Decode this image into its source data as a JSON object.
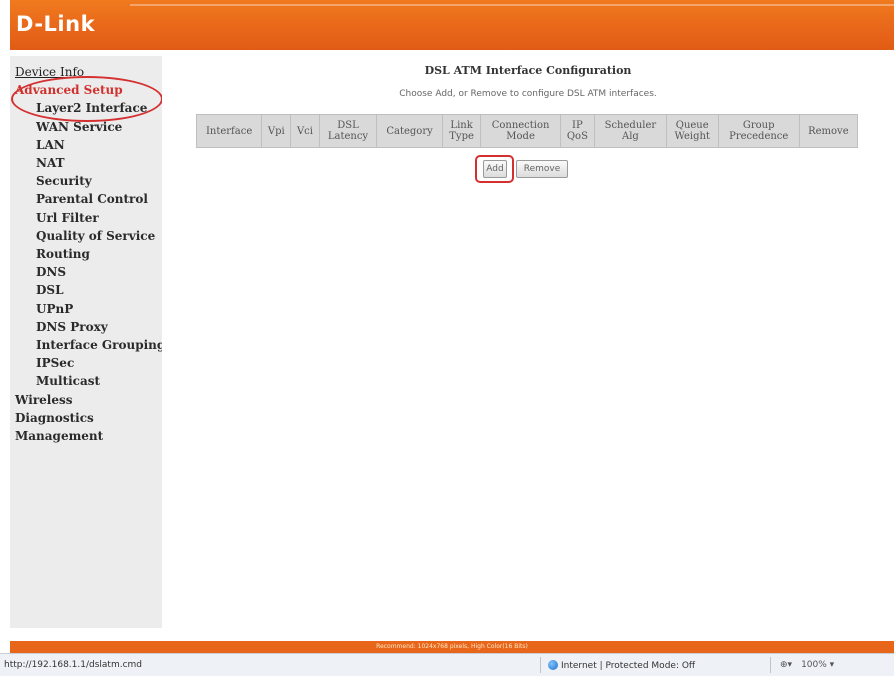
{
  "header": {
    "logo_text": "D-Link"
  },
  "sidebar": {
    "items": [
      {
        "label": "Device Info",
        "level": "top"
      },
      {
        "label": "Advanced Setup",
        "level": "top"
      },
      {
        "label": "Layer2 Interface",
        "level": "sub"
      },
      {
        "label": "WAN Service",
        "level": "sub"
      },
      {
        "label": "LAN",
        "level": "sub"
      },
      {
        "label": "NAT",
        "level": "sub"
      },
      {
        "label": "Security",
        "level": "sub"
      },
      {
        "label": "Parental Control",
        "level": "sub"
      },
      {
        "label": "Url Filter",
        "level": "sub"
      },
      {
        "label": "Quality of Service",
        "level": "sub"
      },
      {
        "label": "Routing",
        "level": "sub"
      },
      {
        "label": "DNS",
        "level": "sub"
      },
      {
        "label": "DSL",
        "level": "sub"
      },
      {
        "label": "UPnP",
        "level": "sub"
      },
      {
        "label": "DNS Proxy",
        "level": "sub"
      },
      {
        "label": "Interface Grouping",
        "level": "sub"
      },
      {
        "label": "IPSec",
        "level": "sub"
      },
      {
        "label": "Multicast",
        "level": "sub"
      },
      {
        "label": "Wireless",
        "level": "top"
      },
      {
        "label": "Diagnostics",
        "level": "top"
      },
      {
        "label": "Management",
        "level": "top"
      }
    ]
  },
  "main": {
    "title": "DSL ATM Interface Configuration",
    "description": "Choose Add, or Remove to configure DSL ATM interfaces.",
    "table": {
      "columns": [
        [
          "Interface"
        ],
        [
          "Vpi"
        ],
        [
          "Vci"
        ],
        [
          "DSL",
          "Latency"
        ],
        [
          "Category"
        ],
        [
          "Link",
          "Type"
        ],
        [
          "Connection",
          "Mode"
        ],
        [
          "IP",
          "QoS"
        ],
        [
          "Scheduler",
          "Alg"
        ],
        [
          "Queue",
          "Weight"
        ],
        [
          "Group",
          "Precedence"
        ],
        [
          "Remove"
        ]
      ]
    },
    "add_label": "Add",
    "remove_label": "Remove"
  },
  "footer": {
    "text": "Recommend: 1024x768 pixels, High Color(16 Bits)"
  },
  "statusbar": {
    "url": "http://192.168.1.1/dslatm.cmd",
    "zone": "Internet | Protected Mode: Off",
    "zoom": "100%"
  }
}
